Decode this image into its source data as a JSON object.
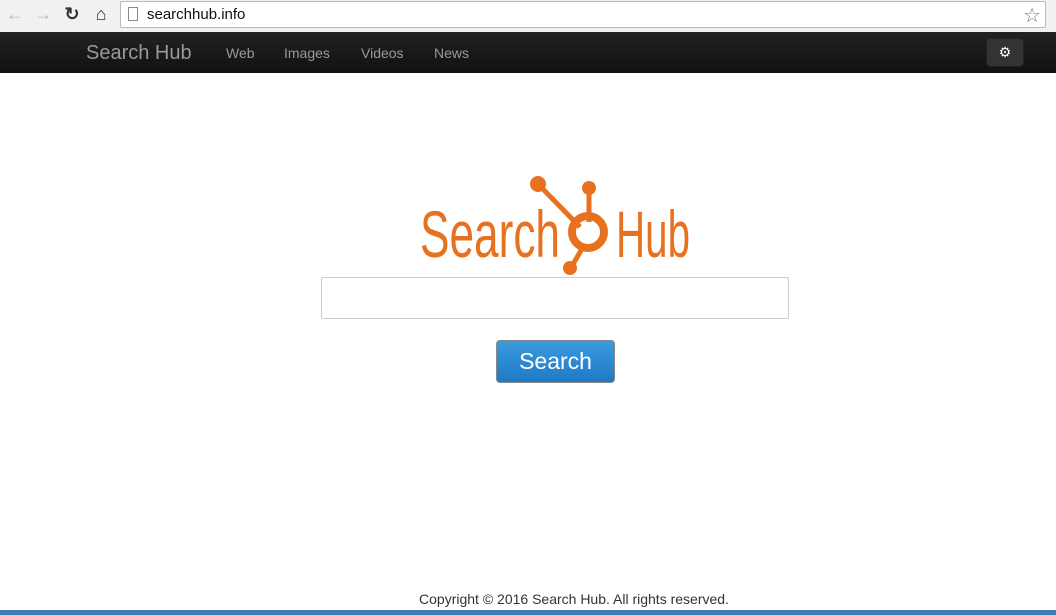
{
  "browser": {
    "url": "searchhub.info"
  },
  "navbar": {
    "brand": "Search Hub",
    "links": [
      "Web",
      "Images",
      "Videos",
      "News"
    ]
  },
  "logo": {
    "text_left": "Search",
    "text_right": "Hub",
    "color": "#e8711f"
  },
  "search": {
    "value": "",
    "button": "Search"
  },
  "footer": {
    "copyright": "Copyright © 2016 Search Hub. All rights reserved."
  }
}
